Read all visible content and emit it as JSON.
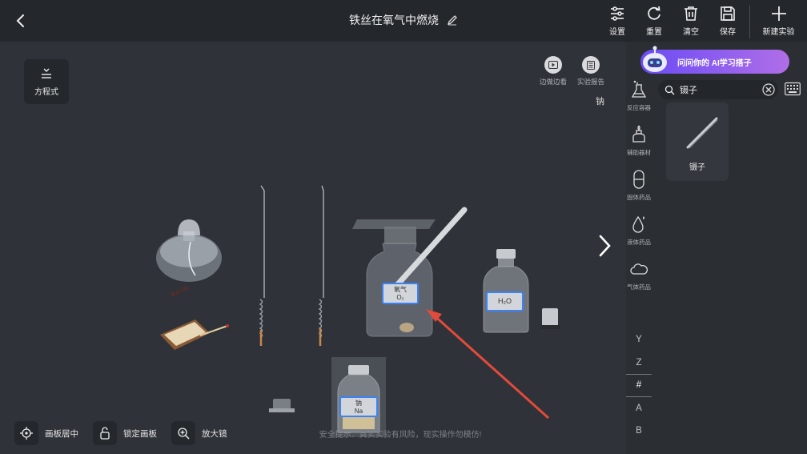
{
  "header": {
    "title": "铁丝在氧气中燃烧",
    "tools": [
      {
        "label": "设置",
        "icon": "sliders-icon"
      },
      {
        "label": "重置",
        "icon": "refresh-icon"
      },
      {
        "label": "清空",
        "icon": "trash-icon"
      },
      {
        "label": "保存",
        "icon": "save-icon"
      }
    ],
    "new_label": "新建实验"
  },
  "canvas": {
    "equation_label": "方程式",
    "watch_label": "边做边看",
    "report_label": "实验报告",
    "selected_label": "钠",
    "oxygen_bottle": {
      "name": "氧气",
      "formula": "O₂"
    },
    "water_bottle": {
      "formula": "H₂O"
    },
    "sodium_bottle": {
      "name": "钠",
      "formula": "Na"
    },
    "matchbox_text": "安全火柴",
    "warning": "安全提示：真实实验有风险，现实操作勿模仿!",
    "bottom_tools": [
      {
        "label": "画板居中",
        "icon": "crosshair-icon"
      },
      {
        "label": "锁定画板",
        "icon": "lock-icon"
      },
      {
        "label": "放大镜",
        "icon": "zoom-in-icon"
      }
    ]
  },
  "sidebar": {
    "banner": "问问你的 AI学习搭子",
    "search_value": "镊子",
    "categories": [
      {
        "label": "反应容器",
        "icon": "flask-icon"
      },
      {
        "label": "辅助器材",
        "icon": "burner-icon"
      },
      {
        "label": "固体药品",
        "icon": "capsule-icon"
      },
      {
        "label": "液体药品",
        "icon": "droplet-icon"
      },
      {
        "label": "气体药品",
        "icon": "cloud-icon"
      }
    ],
    "result": {
      "label": "镊子"
    },
    "letters": [
      "Y",
      "Z",
      "#",
      "A",
      "B"
    ],
    "active_letter": "#"
  }
}
